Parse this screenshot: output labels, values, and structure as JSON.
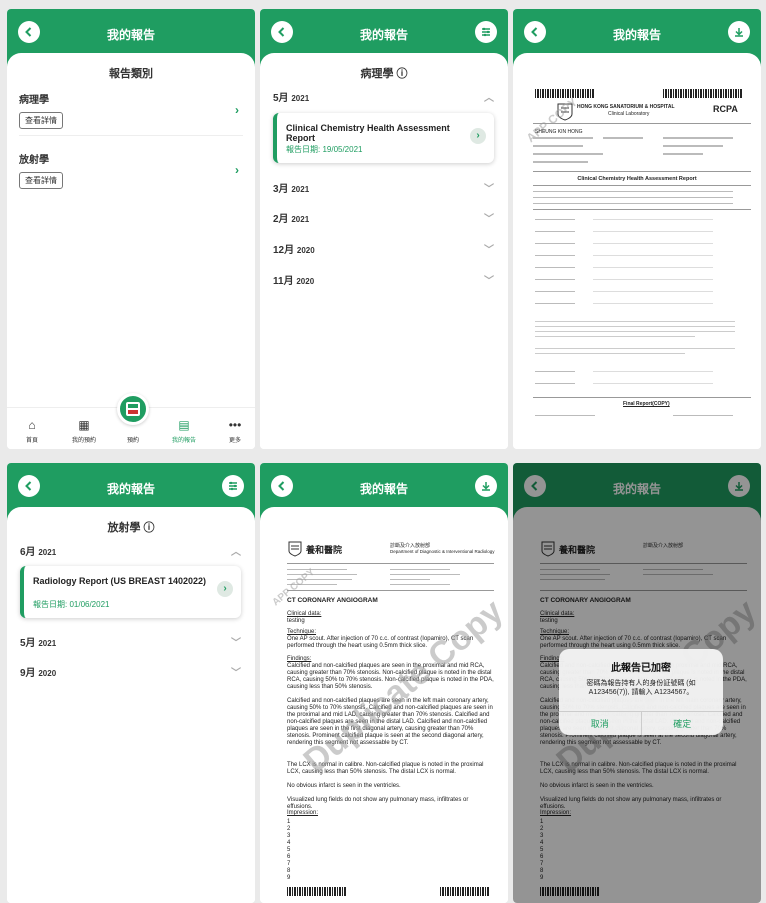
{
  "header_title": "我的報告",
  "s1": {
    "panel_title": "報告類別",
    "categories": [
      {
        "name": "病理學",
        "button": "查看詳情"
      },
      {
        "name": "放射學",
        "button": "查看詳情"
      }
    ],
    "tabs": [
      "首頁",
      "我的預約",
      "預約",
      "我的報告",
      "更多"
    ]
  },
  "s2": {
    "panel_title": "病理學 ⓘ",
    "months": [
      {
        "m": "5月",
        "y": "2021"
      },
      {
        "m": "3月",
        "y": "2021"
      },
      {
        "m": "2月",
        "y": "2021"
      },
      {
        "m": "12月",
        "y": "2020"
      },
      {
        "m": "11月",
        "y": "2020"
      }
    ],
    "card_title": "Clinical Chemistry Health Assessment Report",
    "card_date": "報告日期: 19/05/2021"
  },
  "s3": {
    "hospital": "HONG KONG SANATORIUM & HOSPITAL",
    "lab": "Clinical Laboratory",
    "patient_name": "SHEUNG KIN HONG",
    "report_title": "Clinical Chemistry Health Assessment Report",
    "final_report": "Final Report(COPY)",
    "rcpa": "RCPA",
    "watermark": "APP COPY"
  },
  "s4": {
    "panel_title": "放射學 ⓘ",
    "months": [
      {
        "m": "6月",
        "y": "2021"
      },
      {
        "m": "5月",
        "y": "2021"
      },
      {
        "m": "9月",
        "y": "2020"
      }
    ],
    "card_title": "Radiology Report (US BREAST 1402022)",
    "card_date": "報告日期: 01/06/2021"
  },
  "s5": {
    "hospital_zh": "養和醫院",
    "dept_zh": "診斷及介入放射部",
    "dept_en": "Department of Diagnostic & Interventional Radiology",
    "heading": "CT CORONARY ANGIOGRAM",
    "clinical_label": "Clinical data:",
    "clinical_text": "testing",
    "technique_label": "Technique:",
    "technique_text": "One AP scout. After injection of 70 c.c. of contrast (Iopamiro), CT scan performed through the heart using 0.5mm thick slice.",
    "findings_label": "Findings:",
    "findings_1": "Calcified and non-calcified plaques are seen in the proximal and mid RCA, causing greater than 70% stenosis. Non-calcified plaque is noted in the distal RCA, causing 50% to 70% stenosis. Non-calcified plaque is noted in the PDA, causing less than 50% stenosis.",
    "findings_2": "Calcified and non-calcified plaques are seen in the left main coronary artery, causing 50% to 70% stenosis. Calcified and non-calcified plaques are seen in the proximal and mid LAD, causing greater than 70% stenosis. Calcified and non-calcified plaques are seen in the distal LAD. Calcified and non-calcified plaques are seen in the first diagonal artery, causing greater than 70% stenosis. Prominent calcified plaque is seen at the second diagonal artery, rendering this segment not assessable by CT.",
    "findings_3": "The LCX is normal in calibre. Non-calcified plaque is noted in the proximal LCX, causing less than 50% stenosis. The distal LCX is normal.",
    "findings_4": "No obvious infarct is seen in the ventricles.",
    "findings_5": "Visualized lung fields do not show any pulmonary mass, infiltrates or effusions.",
    "impression_label": "Impression:",
    "numbers": [
      "1",
      "2",
      "3",
      "4",
      "5",
      "6",
      "7",
      "8",
      "9"
    ],
    "watermark": "Duplicate Copy",
    "watermark2": "APP COPY"
  },
  "s6": {
    "modal_title": "此報告已加密",
    "modal_msg": "密碼為報告持有人的身份証號碼 (如A123456(7)), 請輸入 A1234567。",
    "cancel": "取消",
    "confirm": "確定"
  },
  "colors": {
    "accent": "#1f9d61"
  }
}
